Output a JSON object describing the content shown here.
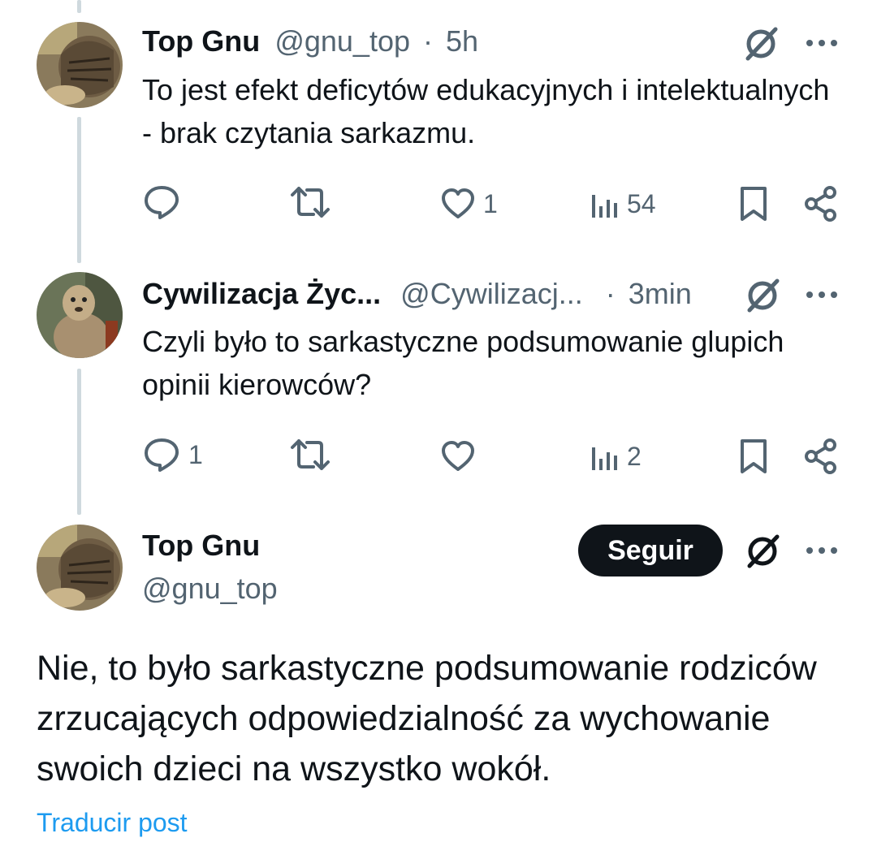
{
  "tweets": [
    {
      "name": "Top Gnu",
      "handle": "@gnu_top",
      "separator": "·",
      "time": "5h",
      "text": "To jest efekt deficytów edukacyjnych i intelektualnych - brak czytania sarkazmu.",
      "reply_count": "",
      "retweet_count": "",
      "like_count": "1",
      "view_count": "54",
      "avatar_icon": "tiger-avatar"
    },
    {
      "name": "Cywilizacja Życ...",
      "handle": "@Cywilizacj...",
      "separator": "·",
      "time": "3min",
      "text": "Czyli było to sarkastyczne podsumowanie glupich opinii kierowców?",
      "reply_count": "1",
      "retweet_count": "",
      "like_count": "",
      "view_count": "2",
      "avatar_icon": "meerkat-avatar"
    }
  ],
  "main_post": {
    "name": "Top Gnu",
    "handle": "@gnu_top",
    "follow_label": "Seguir",
    "text": "Nie, to było sarkastyczne podsumowanie rodziców zrzucających odpowiedzialność za wychowanie swoich dzieci na wszystko wokół.",
    "translate_label": "Traducir post"
  },
  "colors": {
    "text": "#0f1419",
    "secondary": "#536471",
    "link": "#1d9bf0",
    "thread_line": "#cfd9de",
    "button_bg": "#0f1419"
  }
}
